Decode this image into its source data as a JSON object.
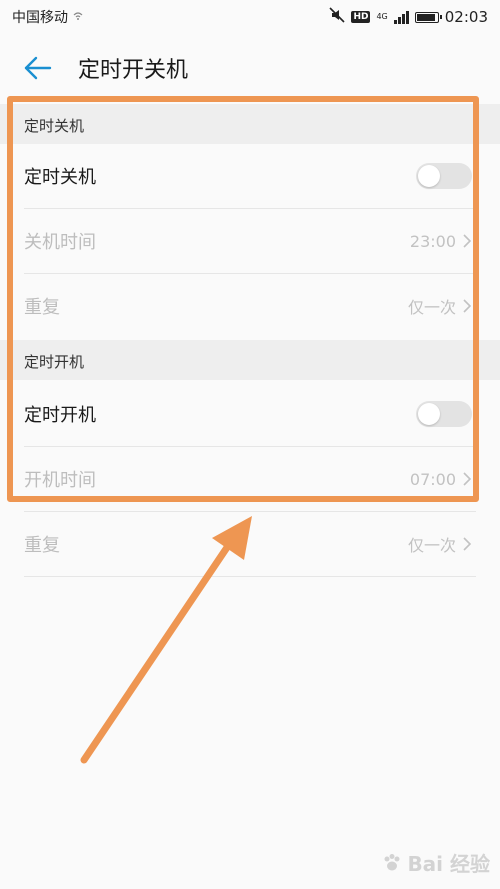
{
  "status_bar": {
    "carrier": "中国移动",
    "network": "4G",
    "hd_badge": "HD",
    "time": "02:03",
    "battery_level": 0.95,
    "icons": [
      "wifi-call-icon",
      "mute-icon",
      "signal-icon",
      "battery-icon"
    ]
  },
  "header": {
    "back_icon": "arrow-left-icon",
    "title": "定时开关机"
  },
  "shutdown_section": {
    "header": "定时关机",
    "toggle_label": "定时关机",
    "toggle_on": false,
    "time_label": "关机时间",
    "time_value": "23:00",
    "repeat_label": "重复",
    "repeat_value": "仅一次"
  },
  "startup_section": {
    "header": "定时开机",
    "toggle_label": "定时开机",
    "toggle_on": false,
    "time_label": "开机时间",
    "time_value": "07:00",
    "repeat_label": "重复",
    "repeat_value": "仅一次"
  },
  "annotation": {
    "box_color": "#ee9652",
    "arrow_color": "#ee9652"
  },
  "watermark": {
    "text": "Bai 经验"
  },
  "colors": {
    "accent": "#1a8fd1",
    "disabled_text": "#bdbdbd",
    "section_bg": "#eeeeee"
  }
}
